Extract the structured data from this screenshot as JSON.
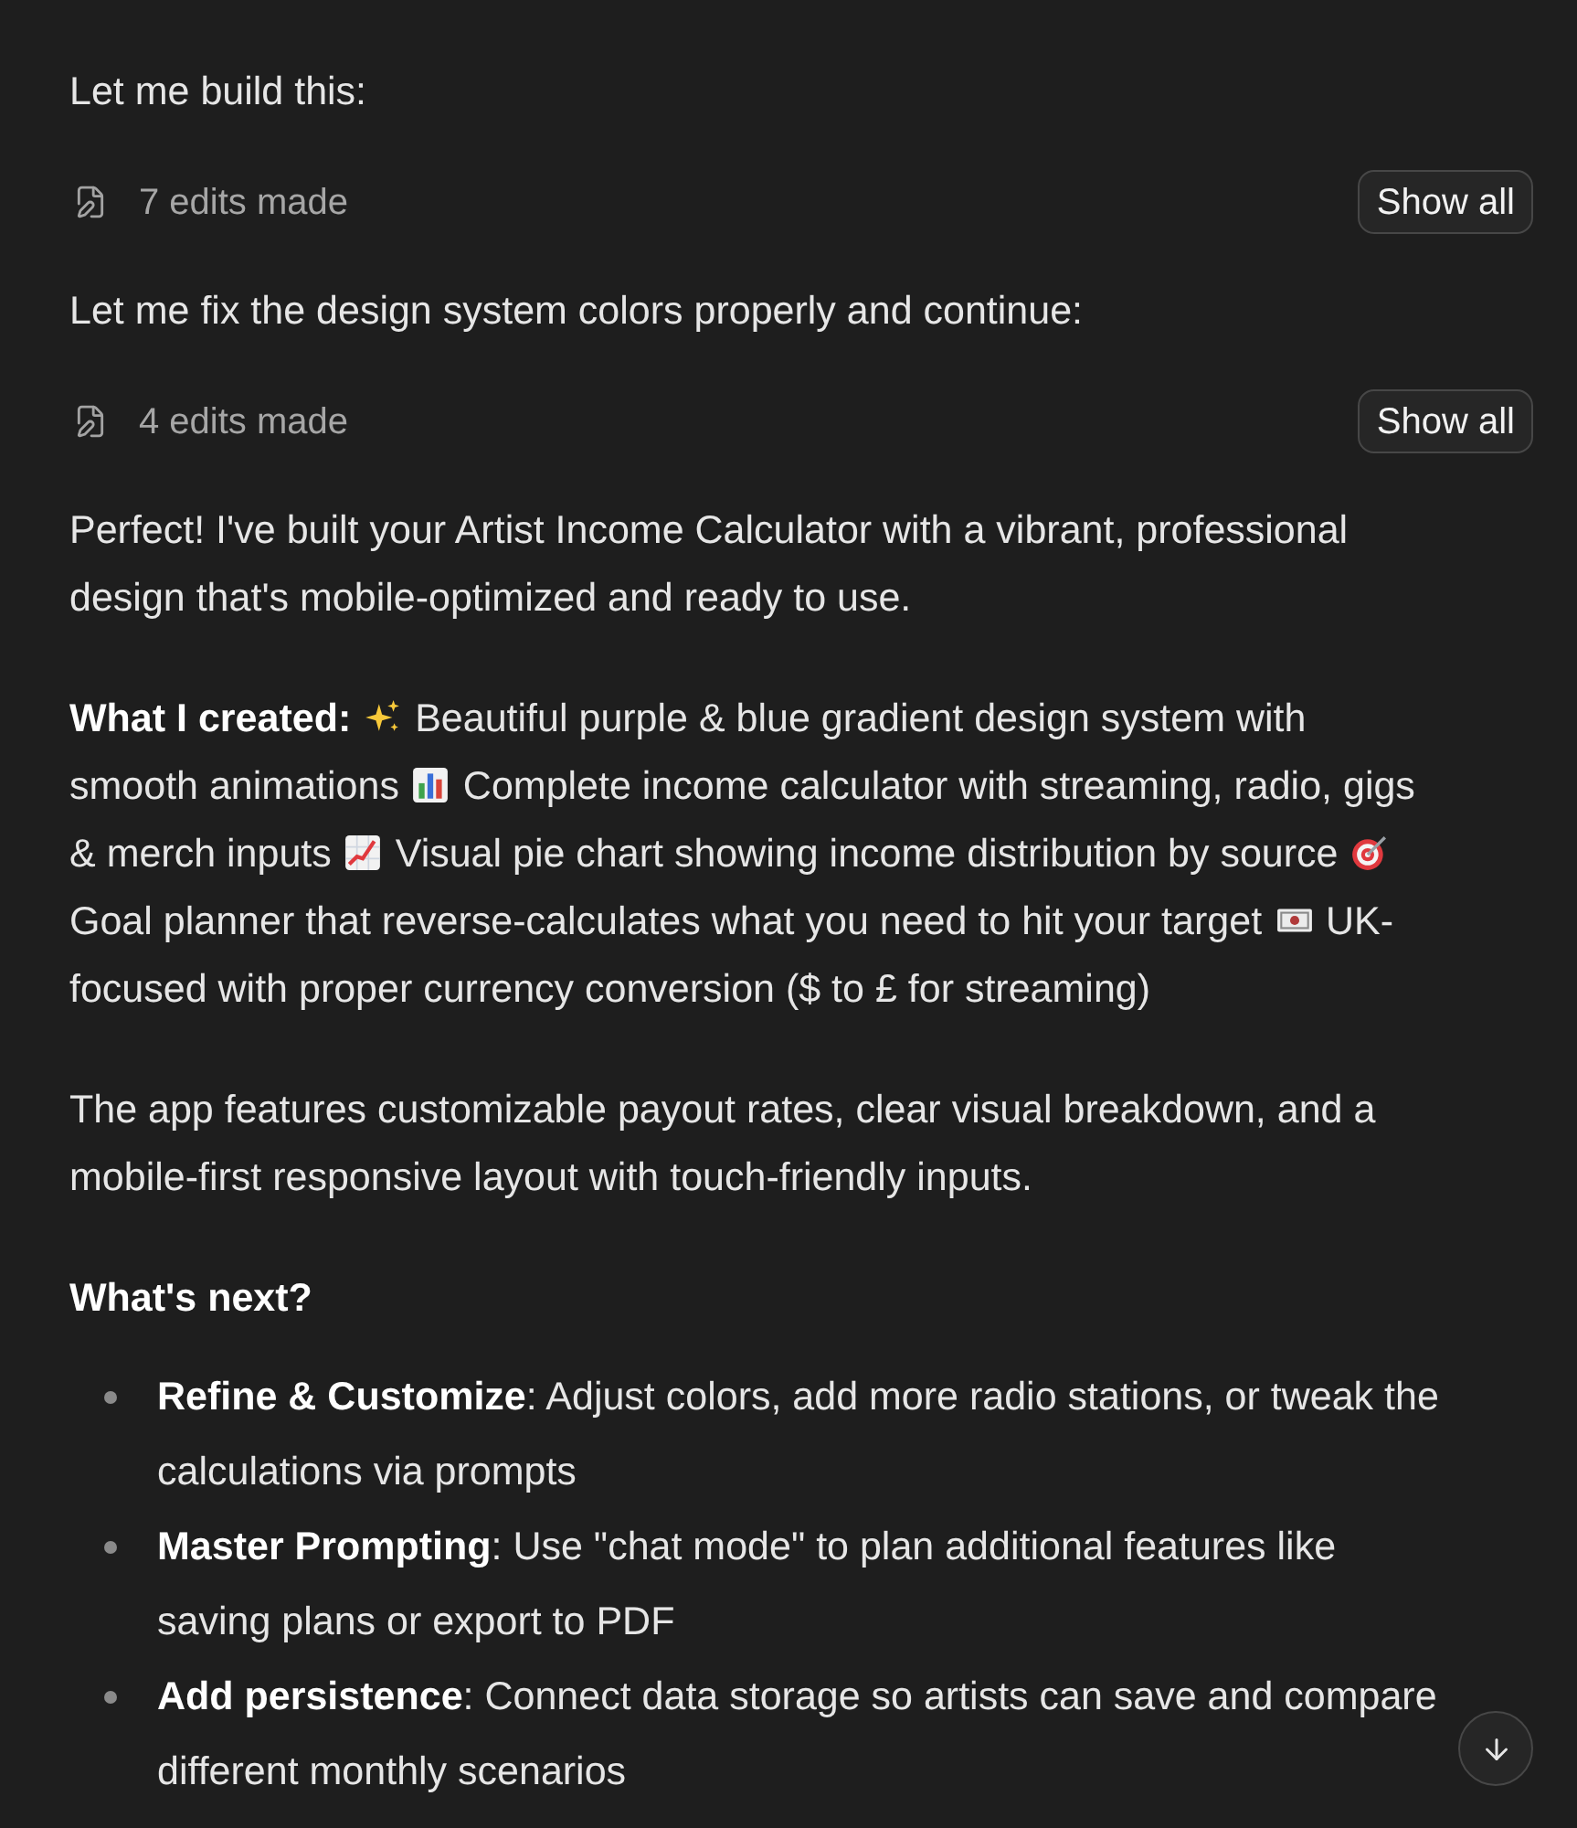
{
  "messages": [
    {
      "kind": "paragraph",
      "text": "Let me build this:"
    },
    {
      "kind": "edits",
      "label": "7 edits made",
      "button": "Show all"
    },
    {
      "kind": "paragraph",
      "text": "Let me fix the design system colors properly and continue:"
    },
    {
      "kind": "edits",
      "label": "4 edits made",
      "button": "Show all"
    },
    {
      "kind": "paragraph",
      "text": "Perfect! I've built your Artist Income Calculator with a vibrant, professional design that's mobile-optimized and ready to use."
    },
    {
      "kind": "mixed",
      "parts": [
        {
          "kind": "text",
          "text": "**What I created:**"
        },
        {
          "kind": "sparkles"
        },
        {
          "kind": "text",
          "text": "Beautiful purple & blue gradient design system with smooth animations"
        },
        {
          "kind": "bar-chart"
        },
        {
          "kind": "text",
          "text": "Complete income calculator with streaming, radio, gigs & merch inputs"
        },
        {
          "kind": "rising-chart"
        },
        {
          "kind": "text",
          "text": "Visual pie chart showing income distribution by source"
        },
        {
          "kind": "target"
        },
        {
          "kind": "text",
          "text": "Goal planner that reverse-calculates what you need to hit your target"
        },
        {
          "kind": "banknote"
        },
        {
          "kind": "text",
          "text": "UK-focused with proper currency conversion ($ to £ for streaming)"
        }
      ]
    },
    {
      "kind": "paragraph",
      "text": "The app features customizable payout rates, clear visual breakdown, and a mobile-first responsive layout with touch-friendly inputs."
    },
    {
      "kind": "heading",
      "text": "What's next?"
    },
    {
      "kind": "bullets",
      "items": [
        "**Refine & Customize**: Adjust colors, add more radio stations, or tweak the calculations via prompts",
        "**Master Prompting**: Use \"chat mode\" to plan additional features like saving plans or export to PDF",
        "**Add persistence**: Connect data storage so artists can save and compare different monthly scenarios"
      ]
    }
  ]
}
